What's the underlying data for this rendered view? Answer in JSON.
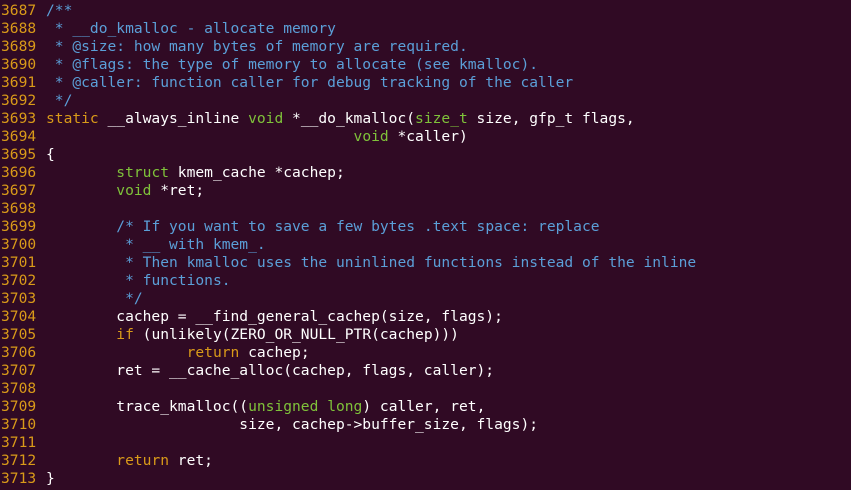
{
  "editor": {
    "lines": [
      {
        "number": "3687",
        "segments": [
          {
            "text": "/**",
            "type": "comment"
          }
        ]
      },
      {
        "number": "3688",
        "segments": [
          {
            "text": " * __do_kmalloc - allocate memory",
            "type": "comment"
          }
        ]
      },
      {
        "number": "3689",
        "segments": [
          {
            "text": " * @size: how many bytes of memory are required.",
            "type": "comment"
          }
        ]
      },
      {
        "number": "3690",
        "segments": [
          {
            "text": " * @flags: the type of memory to allocate (see kmalloc).",
            "type": "comment"
          }
        ]
      },
      {
        "number": "3691",
        "segments": [
          {
            "text": " * @caller: function caller for debug tracking of the caller",
            "type": "comment"
          }
        ]
      },
      {
        "number": "3692",
        "segments": [
          {
            "text": " */",
            "type": "comment"
          }
        ]
      },
      {
        "number": "3693",
        "segments": [
          {
            "text": "static",
            "type": "keyword"
          },
          {
            "text": " __always_inline ",
            "type": "plain"
          },
          {
            "text": "void",
            "type": "type"
          },
          {
            "text": " *__do_kmalloc(",
            "type": "plain"
          },
          {
            "text": "size_t",
            "type": "type"
          },
          {
            "text": " size, gfp_t flags,",
            "type": "plain"
          }
        ]
      },
      {
        "number": "3694",
        "segments": [
          {
            "text": "                                   ",
            "type": "plain"
          },
          {
            "text": "void",
            "type": "type"
          },
          {
            "text": " *caller)",
            "type": "plain"
          }
        ]
      },
      {
        "number": "3695",
        "segments": [
          {
            "text": "{",
            "type": "plain"
          }
        ]
      },
      {
        "number": "3696",
        "segments": [
          {
            "text": "        ",
            "type": "plain"
          },
          {
            "text": "struct",
            "type": "type"
          },
          {
            "text": " kmem_cache *cachep;",
            "type": "plain"
          }
        ]
      },
      {
        "number": "3697",
        "segments": [
          {
            "text": "        ",
            "type": "plain"
          },
          {
            "text": "void",
            "type": "type"
          },
          {
            "text": " *ret;",
            "type": "plain"
          }
        ]
      },
      {
        "number": "3698",
        "segments": []
      },
      {
        "number": "3699",
        "segments": [
          {
            "text": "        ",
            "type": "plain"
          },
          {
            "text": "/* If you want to save a few bytes .text space: replace",
            "type": "comment"
          }
        ]
      },
      {
        "number": "3700",
        "segments": [
          {
            "text": "        ",
            "type": "plain"
          },
          {
            "text": " * __ with kmem_.",
            "type": "comment"
          }
        ]
      },
      {
        "number": "3701",
        "segments": [
          {
            "text": "        ",
            "type": "plain"
          },
          {
            "text": " * Then kmalloc uses the uninlined functions instead of the inline",
            "type": "comment"
          }
        ]
      },
      {
        "number": "3702",
        "segments": [
          {
            "text": "        ",
            "type": "plain"
          },
          {
            "text": " * functions.",
            "type": "comment"
          }
        ]
      },
      {
        "number": "3703",
        "segments": [
          {
            "text": "        ",
            "type": "plain"
          },
          {
            "text": " */",
            "type": "comment"
          }
        ]
      },
      {
        "number": "3704",
        "segments": [
          {
            "text": "        cachep = __find_general_cachep(size, flags);",
            "type": "plain"
          }
        ]
      },
      {
        "number": "3705",
        "segments": [
          {
            "text": "        ",
            "type": "plain"
          },
          {
            "text": "if",
            "type": "keyword"
          },
          {
            "text": " (unlikely(ZERO_OR_NULL_PTR(cachep)))",
            "type": "plain"
          }
        ]
      },
      {
        "number": "3706",
        "segments": [
          {
            "text": "                ",
            "type": "plain"
          },
          {
            "text": "return",
            "type": "keyword"
          },
          {
            "text": " cachep;",
            "type": "plain"
          }
        ]
      },
      {
        "number": "3707",
        "segments": [
          {
            "text": "        ret = __cache_alloc(cachep, flags, caller);",
            "type": "plain"
          }
        ]
      },
      {
        "number": "3708",
        "segments": []
      },
      {
        "number": "3709",
        "segments": [
          {
            "text": "        trace_kmalloc((",
            "type": "plain"
          },
          {
            "text": "unsigned",
            "type": "type"
          },
          {
            "text": " ",
            "type": "plain"
          },
          {
            "text": "long",
            "type": "type"
          },
          {
            "text": ") caller, ret,",
            "type": "plain"
          }
        ]
      },
      {
        "number": "3710",
        "segments": [
          {
            "text": "                      size, cachep->buffer_size, flags);",
            "type": "plain"
          }
        ]
      },
      {
        "number": "3711",
        "segments": []
      },
      {
        "number": "3712",
        "segments": [
          {
            "text": "        ",
            "type": "plain"
          },
          {
            "text": "return",
            "type": "keyword"
          },
          {
            "text": " ret;",
            "type": "plain"
          }
        ]
      },
      {
        "number": "3713",
        "segments": [
          {
            "text": "}",
            "type": "plain"
          }
        ]
      }
    ]
  },
  "colors": {
    "background": "#300a24",
    "line_number": "#d99a19",
    "comment": "#5b9fd8",
    "type": "#7fc23a",
    "keyword": "#d99a19",
    "plain": "#ffffff"
  }
}
